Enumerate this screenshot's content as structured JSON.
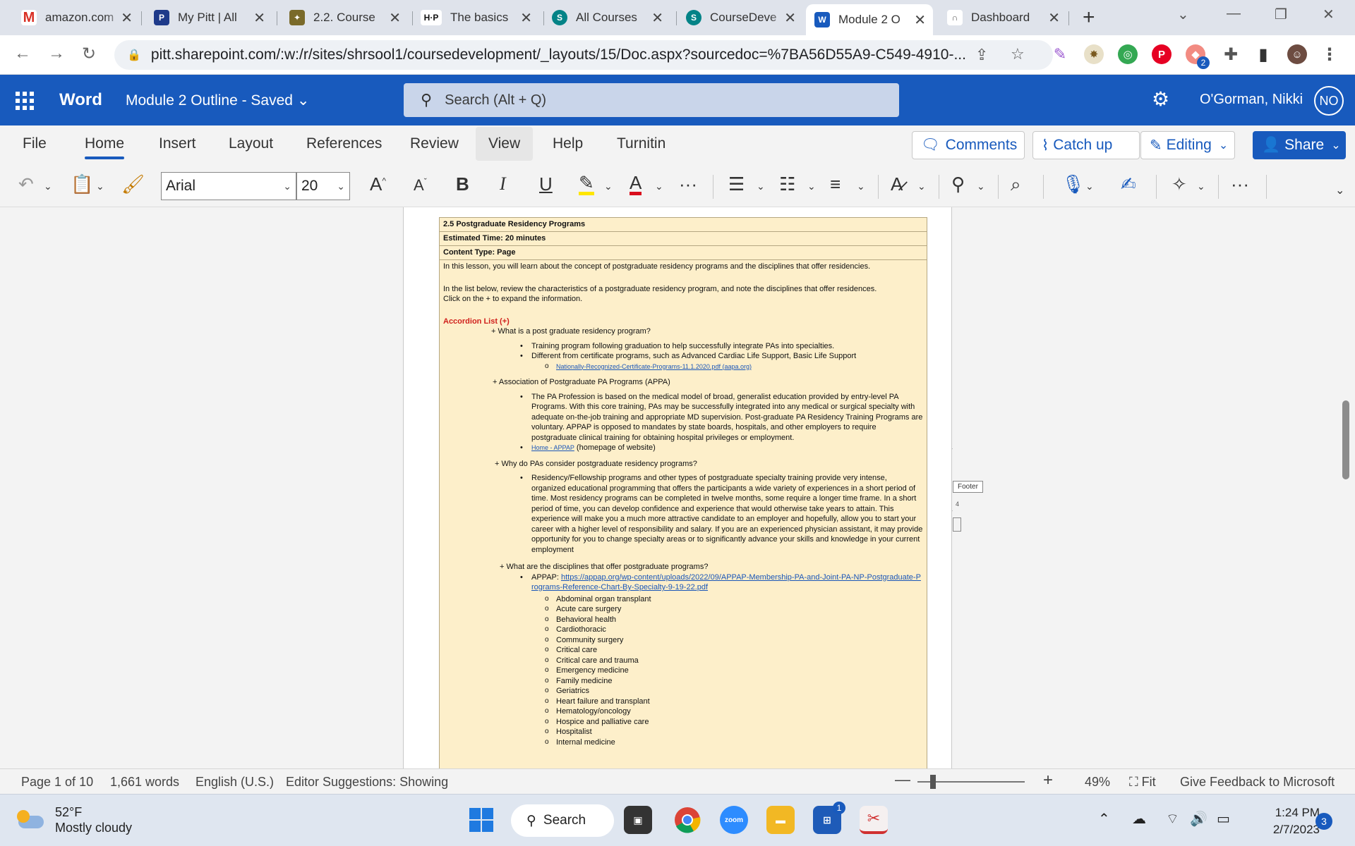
{
  "browser": {
    "tabs": [
      {
        "title": "amazon.com",
        "icon": "gmail-icon",
        "color": "#d93025"
      },
      {
        "title": "My Pitt | All",
        "icon": "pitt-shield-icon",
        "color": "#1e3a8a"
      },
      {
        "title": "2.2. Course",
        "icon": "pitt-seal-icon",
        "color": "#7a6a2a"
      },
      {
        "title": "The basics",
        "icon": "hp-icon",
        "color": "#111111"
      },
      {
        "title": "All Courses",
        "icon": "sharepoint-icon",
        "color": "#038387"
      },
      {
        "title": "CourseDeve",
        "icon": "sharepoint-icon",
        "color": "#038387"
      },
      {
        "title": "Module 2 O",
        "icon": "word-icon",
        "color": "#185abd"
      },
      {
        "title": "Dashboard",
        "icon": "canvas-icon",
        "color": "#555555"
      }
    ],
    "url": "pitt.sharepoint.com/:w:/r/sites/shrsool1/coursedevelopment/_layouts/15/Doc.aspx?sourcedoc=%7BA56D55A9-C549-4910-..."
  },
  "word": {
    "app_name": "Word",
    "doc_title": "Module 2 Outline  -  Saved",
    "search_placeholder": "Search (Alt + Q)",
    "user_name": "O'Gorman, Nikki",
    "user_initials": "NO",
    "ribbon_tabs": [
      "File",
      "Home",
      "Insert",
      "Layout",
      "References",
      "Review",
      "View",
      "Help",
      "Turnitin"
    ],
    "buttons": {
      "comments": "Comments",
      "catch_up": "Catch up",
      "editing": "Editing",
      "share": "Share"
    },
    "font_name": "Arial",
    "font_size": "20"
  },
  "document": {
    "header_rows": [
      "2.5 Postgraduate Residency Programs",
      "Estimated Time: 20 minutes",
      "Content Type: Page"
    ],
    "intro1": "In this lesson, you will learn about the concept of postgraduate residency programs and the disciplines that offer residencies.",
    "intro2": "In the list below, review the characteristics of a postgraduate residency program, and note the disciplines that offer residences.",
    "intro3": "Click on the + to expand the information.",
    "accordion_label": "Accordion List (+)",
    "q1": "+ What is a post graduate residency program?",
    "q1_b1": "Training program following graduation to help successfully integrate PAs into specialties.",
    "q1_b2": "Different from certificate programs, such as Advanced Cardiac Life Support, Basic Life Support",
    "q1_link": "Nationally-Recognized-Certificate-Programs-11.1.2020.pdf (aapa.org)",
    "q2": "+ Association of Postgraduate PA Programs (APPA)",
    "q2_b1": "The PA Profession is based on the medical model of broad, generalist education provided by entry-level PA Programs. With this core training, PAs may be successfully integrated into any medical or surgical specialty with adequate on-the-job training and appropriate MD supervision. Post-graduate PA Residency Training Programs are voluntary. APPAP is opposed to mandates by state boards, hospitals, and other employers to require postgraduate clinical training for obtaining hospital privileges or employment.",
    "q2_link": "Home - APPAP",
    "q2_link_suffix": " (homepage of website)",
    "q3": "+ Why do PAs consider postgraduate residency programs?",
    "q3_b1": "Residency/Fellowship programs and other types of postgraduate specialty training provide very intense, organized educational programming that offers the participants a wide variety of experiences in a short period of time. Most residency programs can be completed in twelve months, some require a longer time frame. In a short period of time, you can develop confidence and experience that would otherwise take years to attain. This experience will make you a much more attractive candidate to an employer and hopefully, allow you to start your career with a higher level of responsibility and salary. If you are an experienced physician assistant, it may provide opportunity for you to change specialty areas or to significantly advance your skills and knowledge in your current employment",
    "q4": "+ What are the disciplines that offer postgraduate programs?",
    "q4_prefix": "APPAP: ",
    "q4_link": "https://appap.org/wp-content/uploads/2022/09/APPAP-Membership-PA-and-Joint-PA-NP-Postgraduate-Programs-Reference-Chart-By-Specialty-9-19-22.pdf",
    "disciplines": [
      "Abdominal organ transplant",
      "Acute care surgery",
      "Behavioral health",
      "Cardiothoracic",
      "Community surgery",
      "Critical care",
      "Critical care and trauma",
      "Emergency medicine",
      "Family medicine",
      "Geriatrics",
      "Heart failure and transplant",
      "Hematology/oncology",
      "Hospice and palliative care",
      "Hospitalist",
      "Internal medicine"
    ],
    "footer_label": "Footer",
    "footer_number": "4"
  },
  "status": {
    "page": "Page 1 of 10",
    "words": "1,661 words",
    "language": "English (U.S.)",
    "editor": "Editor Suggestions: Showing",
    "zoom": "49%",
    "fit": "Fit",
    "feedback": "Give Feedback to Microsoft"
  },
  "taskbar": {
    "temp": "52°F",
    "condition": "Mostly cloudy",
    "search": "Search",
    "time": "1:24 PM",
    "date": "2/7/2023",
    "notifications": "3",
    "store_badge": "1",
    "ext_badge": "2"
  }
}
